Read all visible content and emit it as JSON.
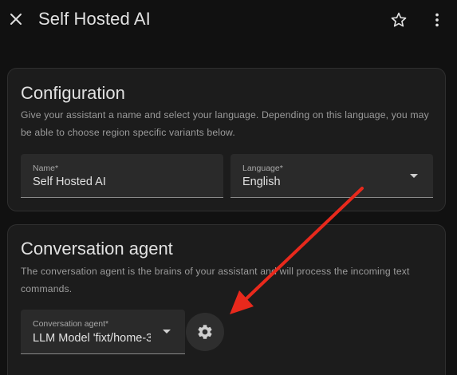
{
  "header": {
    "title": "Self Hosted AI",
    "close_icon": "close-icon",
    "star_icon": "star-outline-icon",
    "more_icon": "more-vertical-icon"
  },
  "configuration": {
    "title": "Configuration",
    "description": "Give your assistant a name and select your language. Depending on this language, you may be able to choose region specific variants below.",
    "name_field": {
      "label": "Name*",
      "value": "Self Hosted AI"
    },
    "language_field": {
      "label": "Language*",
      "value": "English"
    }
  },
  "conversation_agent": {
    "title": "Conversation agent",
    "description": "The conversation agent is the brains of your assistant and will process the incoming text commands.",
    "agent_field": {
      "label": "Conversation agent*",
      "value": "LLM Model 'fixt/home-3"
    },
    "settings_icon": "gear-icon"
  },
  "annotation": {
    "arrow_color": "#e8291c"
  },
  "colors": {
    "background": "#111111",
    "card": "#1c1c1c",
    "field": "#2a2a2a",
    "text": "#e1e1e1",
    "secondary_text": "#9b9b9b"
  }
}
